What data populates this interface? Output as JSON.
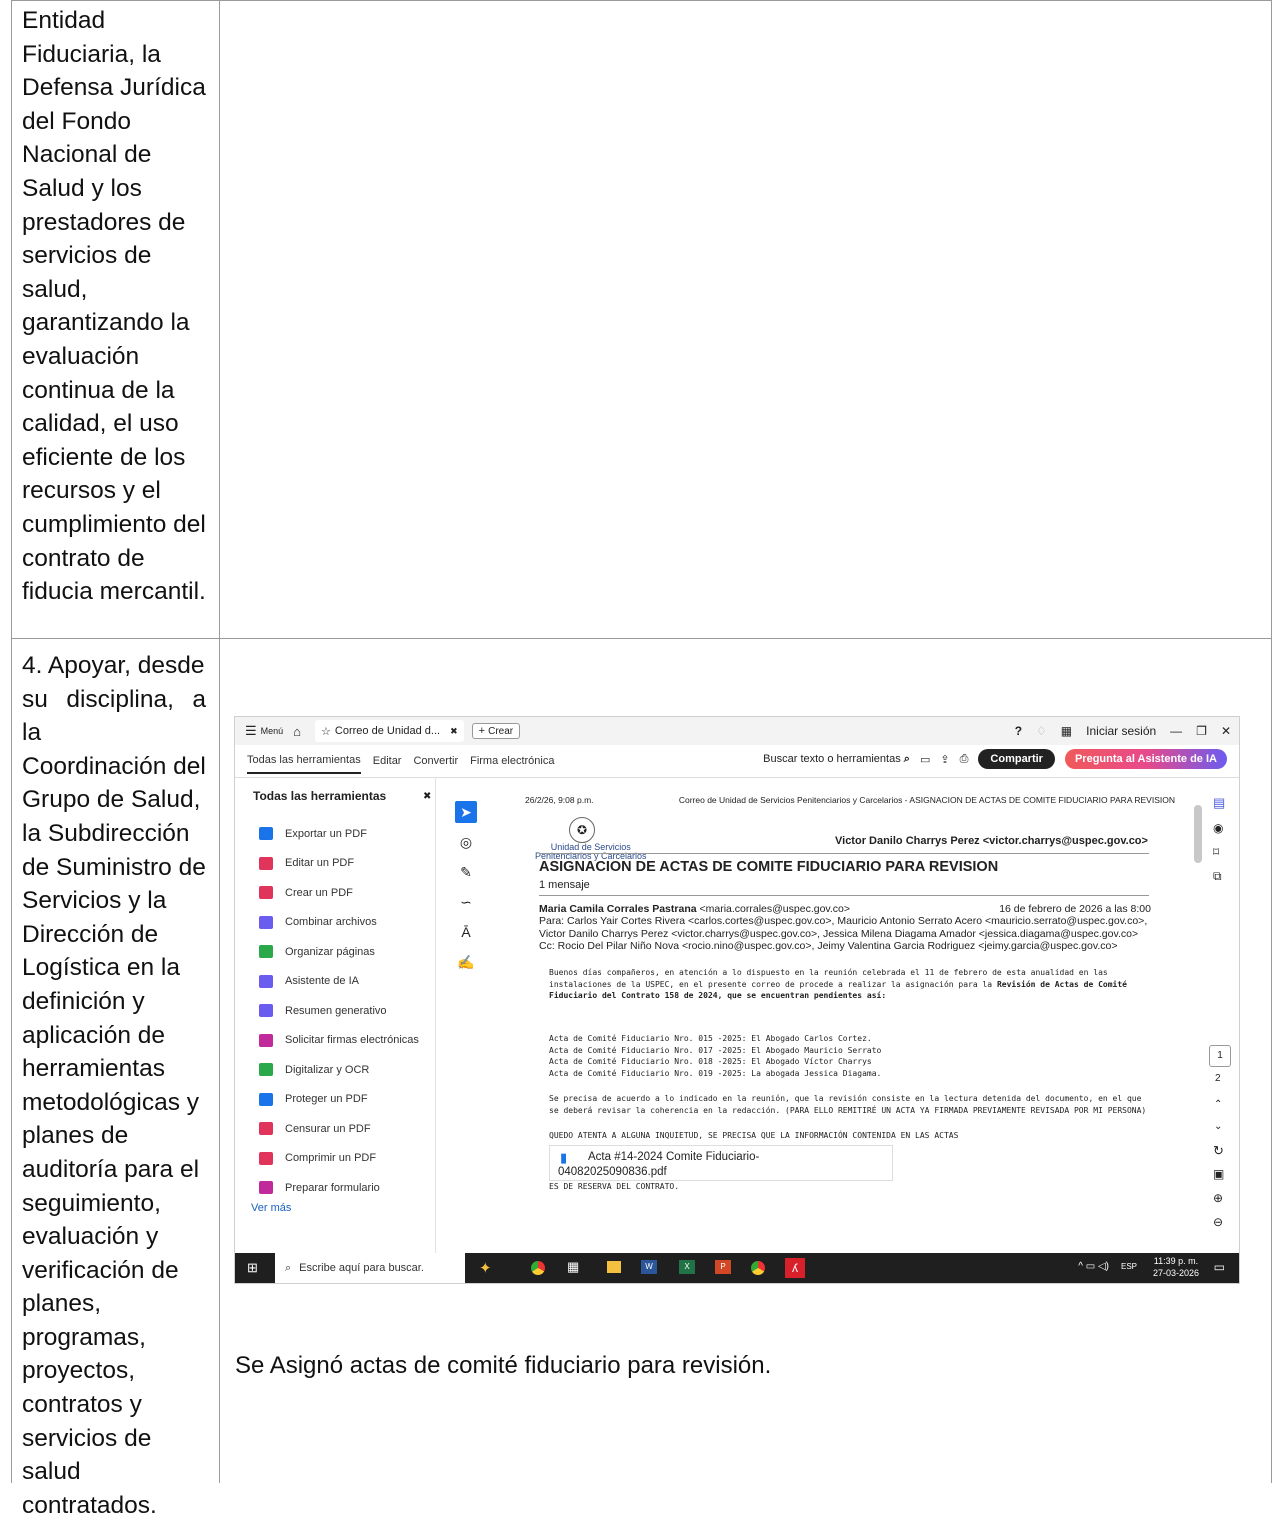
{
  "row1_text": [
    "Entidad",
    "Fiduciaria, la",
    "Defensa Jurídica",
    "del Fondo",
    "Nacional de",
    "Salud y los",
    "prestadores de",
    "servicios de",
    "salud,",
    "garantizando la",
    "evaluación",
    "continua de la",
    "calidad, el uso",
    "eficiente de los",
    "recursos y el",
    "cumplimiento del",
    "contrato de",
    "fiducia mercantil."
  ],
  "row2_text": [
    "4. Apoyar, desde",
    "su disciplina, a la",
    "Coordinación del",
    "Grupo de Salud,",
    "la Subdirección",
    "de Suministro de",
    "Servicios y la",
    "Dirección de",
    "Logística en la",
    "definición y",
    "aplicación de",
    "herramientas",
    "metodológicas y",
    "planes de",
    "auditoría para el",
    "seguimiento,",
    "evaluación y",
    "verificación de",
    "planes,",
    "programas,",
    "proyectos,",
    "contratos y",
    "servicios de",
    "salud",
    "contratados."
  ],
  "caption": "Se Asignó actas de comité fiduciario para revisión.",
  "screenshot": {
    "titlebar": {
      "menu": "Menú",
      "tab": "Correo de Unidad d...",
      "create": "Crear",
      "signin": "Iniciar sesión"
    },
    "menubar": {
      "items": [
        "Todas las herramientas",
        "Editar",
        "Convertir",
        "Firma electrónica"
      ],
      "search": "Buscar texto o herramientas",
      "share": "Compartir",
      "ai": "Pregunta al Asistente de IA"
    },
    "sidebar": {
      "title": "Todas las herramientas",
      "items": [
        {
          "label": "Exportar un PDF",
          "color": "#1a73e8"
        },
        {
          "label": "Editar un PDF",
          "color": "#e0345a"
        },
        {
          "label": "Crear un PDF",
          "color": "#e0345a"
        },
        {
          "label": "Combinar archivos",
          "color": "#6b5cf0"
        },
        {
          "label": "Organizar páginas",
          "color": "#2aa84a"
        },
        {
          "label": "Asistente de IA",
          "color": "#6b5cf0"
        },
        {
          "label": "Resumen generativo",
          "color": "#6b5cf0"
        },
        {
          "label": "Solicitar firmas electrónicas",
          "color": "#c02a9a"
        },
        {
          "label": "Digitalizar y OCR",
          "color": "#2aa84a"
        },
        {
          "label": "Proteger un PDF",
          "color": "#1a73e8"
        },
        {
          "label": "Censurar un PDF",
          "color": "#e0345a"
        },
        {
          "label": "Comprimir un PDF",
          "color": "#e0345a"
        },
        {
          "label": "Preparar formulario",
          "color": "#c02a9a"
        }
      ],
      "more": "Ver más"
    },
    "doc": {
      "header_left": "26/2/26, 9:08 p.m.",
      "header_right": "Correo de Unidad de Servicios Penitenciarios y Carcelarios - ASIGNACION DE ACTAS DE COMITE FIDUCIARIO PARA REVISION",
      "logo_line1": "Unidad de Servicios",
      "logo_line2": "Penitenciarios y Carcelarios",
      "account": "Victor Danilo Charrys Perez <victor.charrys@uspec.gov.co>",
      "subject": "ASIGNACION DE ACTAS DE COMITE FIDUCIARIO PARA REVISION",
      "messages": "1 mensaje",
      "from_name": "Maria Camila Corrales Pastrana",
      "from_email": " <maria.corrales@uspec.gov.co>",
      "date": "16 de febrero de 2026 a las 8:00",
      "to": "Para: Carlos Yair Cortes Rivera <carlos.cortes@uspec.gov.co>, Mauricio Antonio Serrato Acero <mauricio.serrato@uspec.gov.co>, Victor Danilo Charrys Perez <victor.charrys@uspec.gov.co>, Jessica Milena Diagama Amador <jessica.diagama@uspec.gov.co>",
      "cc": "Cc: Rocio Del Pilar Niño Nova <rocio.nino@uspec.gov.co>, Jeimy Valentina Garcia Rodriguez <jeimy.garcia@uspec.gov.co>",
      "body1": "Buenos días compañeros, en atención a lo dispuesto en la reunión celebrada el 11 de febrero de esta anualidad en las instalaciones de la USPEC, en el presente correo de procede a realizar la asignación para la ",
      "body1_bold": "Revisión de Actas de Comité Fiduciario del Contrato 158 de 2024, que se encuentran pendientes así:",
      "actas": [
        "Acta de Comité Fiduciario Nro. 015 -2025: El Abogado Carlos Cortez.",
        "Acta de Comité Fiduciario Nro. 017 -2025: El Abogado Mauricio Serrato",
        "Acta de Comité Fiduciario Nro. 018 -2025: El  Abogado Víctor Charrys",
        "Acta de Comité Fiduciario Nro. 019 -2025: La abogada Jessica Diagama."
      ],
      "body2": "Se precisa de acuerdo a lo indicado en la reunión, que la revisión consiste en la lectura detenida del documento, en el que se deberá revisar la coherencia en la redacción. (PARA ELLO REMITIRÉ UN ACTA YA FIRMADA PREVIAMENTE  REVISADA POR MI PERSONA)",
      "body3": "QUEDO ATENTA A ALGUNA INQUIETUD, SE PRECISA QUE LA INFORMACIÓN CONTENIDA EN LAS ACTAS",
      "attachment_line1": "Acta #14-2024 Comite Fiduciario-",
      "attachment_line2": "04082025090836.pdf",
      "body4": "ES DE RESERVA DEL CONTRATO."
    },
    "pages": [
      "1",
      "2"
    ],
    "taskbar": {
      "search": "Escribe aquí para buscar.",
      "lang": "ESP",
      "time": "11:39 p. m.",
      "date": "27-03-2026"
    }
  }
}
